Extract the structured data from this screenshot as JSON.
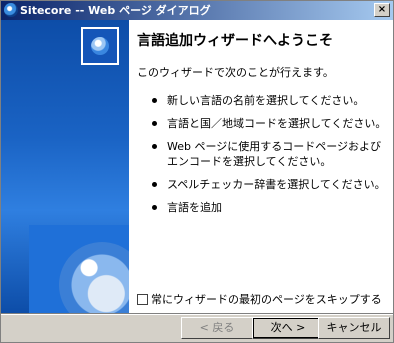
{
  "window": {
    "title": "Sitecore -- Web ページ ダイアログ",
    "close_label": "×",
    "title_icon": "globe-icon"
  },
  "wizard": {
    "heading": "言語追加ウィザードへようこそ",
    "intro": "このウィザードで次のことが行えます。",
    "steps": [
      "新しい言語の名前を選択してください。",
      "言語と国／地域コードを選択してください。",
      "Web ページに使用するコードページおよびエンコードを選択してください。",
      "スペルチェッカー辞書を選択してください。",
      "言語を追加"
    ],
    "skip_label": "常にウィザードの最初のページをスキップする",
    "skip_checked": false
  },
  "buttons": {
    "back": "< 戻る",
    "next": "次へ >",
    "cancel": "キャンセル"
  },
  "colors": {
    "titlebar_start": "#0a246a",
    "sidebar": "#1a63c4",
    "dialog_bg": "#d4d0c8"
  }
}
